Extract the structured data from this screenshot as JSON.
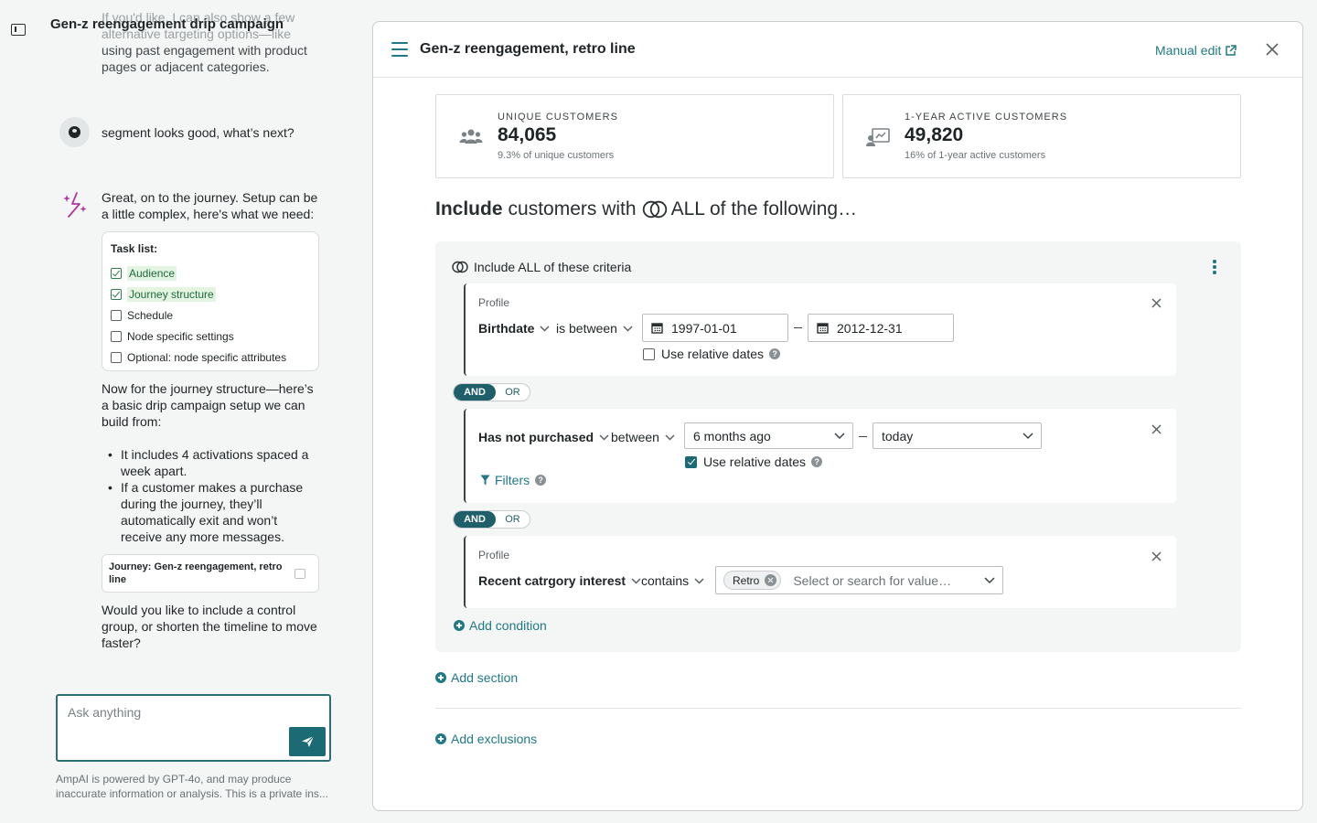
{
  "chat": {
    "title": "Gen-z reengagement drip campaign",
    "faded_lines": [
      "If you'd like, I can also show a few",
      "alternative targeting options—like",
      "using past engagement with product",
      "pages or adjacent categories."
    ],
    "user_message": "segment looks good, what’s next?",
    "ai_intro": "Great, on to the journey.  Setup can be a little complex, here's what we need:",
    "task_list": {
      "title": "Task list:",
      "items": [
        {
          "label": "Audience",
          "done": true
        },
        {
          "label": "Journey structure",
          "done": true
        },
        {
          "label": "Schedule",
          "done": false
        },
        {
          "label": "Node specific settings",
          "done": false
        },
        {
          "label": "Optional: node specific attributes",
          "done": false
        }
      ]
    },
    "ai_structure": "Now for the journey structure—here’s a basic drip campaign setup we can build from:",
    "bullets": [
      "It includes 4 activations spaced a week apart.",
      "If a customer makes a purchase during the journey, they’ll automatically exit and won’t receive any more messages."
    ],
    "journey_card": "Journey: Gen-z reengagement, retro line",
    "ai_question": "Would you like to include a control group, or shorten the timeline to move faster?",
    "input_placeholder": "Ask anything",
    "disclaimer": "AmpAI is powered by GPT-4o, and may produce inaccurate information or analysis. This is a private ins..."
  },
  "panel": {
    "title": "Gen-z reengagement, retro line",
    "manual_edit": "Manual edit",
    "stats": [
      {
        "label": "UNIQUE CUSTOMERS",
        "value": "84,065",
        "sub": "9.3% of unique customers"
      },
      {
        "label": "1-YEAR ACTIVE CUSTOMERS",
        "value": "49,820",
        "sub": "16% of 1-year active customers"
      }
    ],
    "heading": {
      "bold": "Include",
      "mid": "customers with",
      "rest": "ALL of the following…"
    },
    "criteria_header": "Include ALL of these criteria",
    "cond1": {
      "category": "Profile",
      "property": "Birthdate",
      "operator": "is between",
      "from": "1997-01-01",
      "to": "2012-12-31",
      "relative_label": "Use relative dates",
      "relative_checked": false
    },
    "andor": {
      "and": "AND",
      "or": "OR"
    },
    "cond2": {
      "property": "Has not purchased",
      "operator": "between",
      "from": "6 months ago",
      "to": "today",
      "relative_label": "Use relative dates",
      "relative_checked": true,
      "filters": "Filters"
    },
    "cond3": {
      "category": "Profile",
      "property": "Recent catrgory interest",
      "operator": "contains",
      "tag": "Retro",
      "placeholder": "Select or search for value…"
    },
    "add_condition": "Add condition",
    "add_section": "Add section",
    "add_exclusions": "Add exclusions"
  },
  "colors": {
    "accent": "#1f7a85",
    "dark_accent": "#1f5f69",
    "success": "#2e7d4f"
  }
}
